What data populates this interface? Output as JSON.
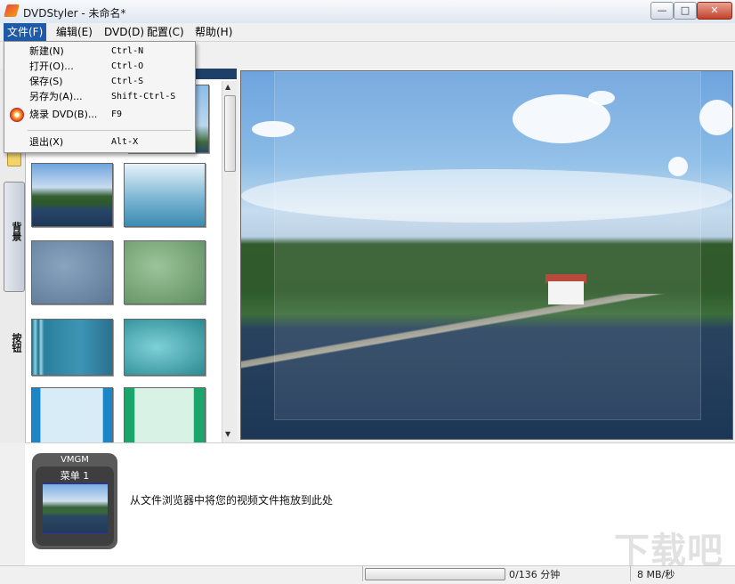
{
  "window": {
    "title": "DVDStyler - 未命名*",
    "controls": {
      "minimize": "—",
      "maximize": "□",
      "close": "✕"
    }
  },
  "menubar": {
    "items": [
      {
        "label": "文件(F)"
      },
      {
        "label": "编辑(E)"
      },
      {
        "label": "DVD(D)"
      },
      {
        "label": "配置(C)"
      },
      {
        "label": "帮助(H)"
      }
    ]
  },
  "file_menu": {
    "items": [
      {
        "label": "新建(N)",
        "shortcut": "Ctrl-N"
      },
      {
        "label": "打开(O)...",
        "shortcut": "Ctrl-O"
      },
      {
        "label": "保存(S)",
        "shortcut": "Ctrl-S"
      },
      {
        "label": "另存为(A)...",
        "shortcut": "Shift-Ctrl-S"
      },
      {
        "label": "烧录 DVD(B)...",
        "shortcut": "F9",
        "icon": "burn-disc-icon"
      },
      {
        "label": "退出(X)",
        "shortcut": "Alt-X"
      }
    ]
  },
  "side_tabs": {
    "background": "背景",
    "buttons": "按钮"
  },
  "menu_preview": {
    "vmgm_label": "VMGM",
    "menu_label": "菜单 1"
  },
  "hint": "从文件浏览器中将您的视频文件拖放到此处",
  "status": {
    "duration": "0/136 分钟",
    "speed": "8 MB/秒",
    "progress": 0
  },
  "watermark": "下载吧",
  "colors": {
    "menu_highlight": "#1e5aa8",
    "panel_header": "#1e3f68"
  }
}
